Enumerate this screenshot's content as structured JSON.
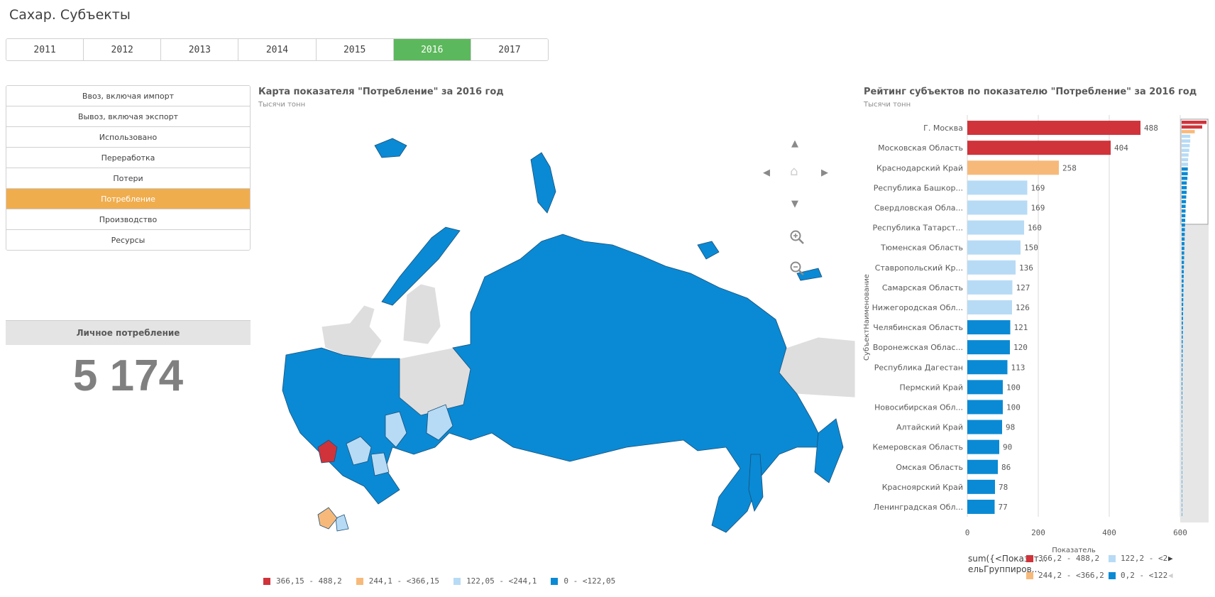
{
  "app": {
    "title": "Сахар. Субъекты"
  },
  "years": [
    "2011",
    "2012",
    "2013",
    "2014",
    "2015",
    "2016",
    "2017"
  ],
  "selected_year": "2016",
  "indicators": [
    "Ввоз, включая импорт",
    "Вывоз, включая экспорт",
    "Использовано",
    "Переработка",
    "Потери",
    "Потребление",
    "Производство",
    "Ресурсы"
  ],
  "selected_indicator": "Потребление",
  "kpi": {
    "label": "Личное потребление",
    "value": "5 174"
  },
  "map": {
    "title": "Карта показателя \"Потребление\" за 2016 год",
    "subtitle": "Тысячи тонн",
    "nav_icons": [
      "arrow-up-icon",
      "arrow-left-icon",
      "home-icon",
      "arrow-right-icon",
      "arrow-down-icon",
      "zoom-in-icon",
      "zoom-out-icon"
    ],
    "legend": [
      {
        "label": "366,15 - 488,2",
        "color": "#d0333a"
      },
      {
        "label": "244,1 - <366,15",
        "color": "#f7b97a"
      },
      {
        "label": "122,05 - <244,1",
        "color": "#b7dbf5"
      },
      {
        "label": "0 - <122,05",
        "color": "#0a8ad4"
      }
    ],
    "no_data_color": "#dedede"
  },
  "colors": {
    "accent_green": "#5cb85c",
    "accent_orange": "#f0ad4e"
  },
  "chart_data": {
    "type": "bar",
    "orientation": "horizontal",
    "title": "Рейтинг субъектов по показателю \"Потребление\" за 2016 год",
    "subtitle": "Тысячи тонн",
    "xlabel": "Показатель",
    "ylabel": "СубъектНаименование",
    "xlim": [
      0,
      600
    ],
    "xticks": [
      0,
      200,
      400,
      600
    ],
    "grid": true,
    "categories": [
      "Г. Москва",
      "Московская Область",
      "Краснодарский Край",
      "Республика Башкор...",
      "Свердловская Обла...",
      "Республика Татарст...",
      "Тюменская Область",
      "Ставропольский Кр...",
      "Самарская Область",
      "Нижегородская Обл...",
      "Челябинская Область",
      "Воронежская Облас...",
      "Республика Дагестан",
      "Пермский Край",
      "Новосибирская Обл...",
      "Алтайский Край",
      "Кемеровская Область",
      "Омская Область",
      "Красноярский Край",
      "Ленинградская Обл..."
    ],
    "values": [
      488,
      404,
      258,
      169,
      169,
      160,
      150,
      136,
      127,
      126,
      121,
      120,
      113,
      100,
      100,
      98,
      90,
      86,
      78,
      77
    ],
    "legend": {
      "title": "sum({<Показат... ельГруппиров...",
      "entries": [
        {
          "label": "366,2 - 488,2",
          "color": "#d0333a"
        },
        {
          "label": "122,2 - <2",
          "color": "#b7dbf5"
        },
        {
          "label": "244,2 - <366,2",
          "color": "#f7b97a"
        },
        {
          "label": "0,2 - <122",
          "color": "#0a8ad4"
        }
      ]
    }
  }
}
